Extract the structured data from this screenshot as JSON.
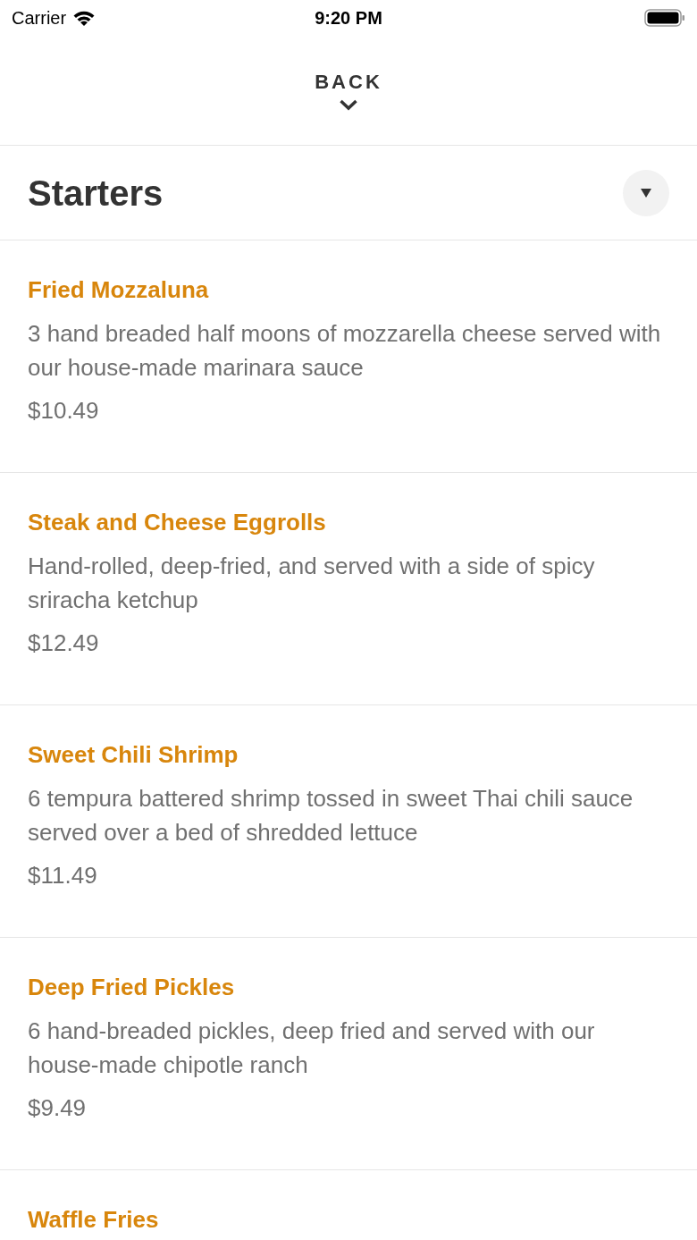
{
  "status_bar": {
    "carrier": "Carrier",
    "time": "9:20 PM"
  },
  "header": {
    "back_label": "BACK"
  },
  "section": {
    "title": "Starters"
  },
  "items": [
    {
      "name": "Fried Mozzaluna",
      "description": "3 hand breaded half moons of mozzarella cheese served with our house-made marinara sauce",
      "price": "$10.49"
    },
    {
      "name": "Steak and Cheese Eggrolls",
      "description": "Hand-rolled, deep-fried, and served with a side of spicy sriracha ketchup",
      "price": "$12.49"
    },
    {
      "name": "Sweet Chili Shrimp",
      "description": "6 tempura battered shrimp tossed in sweet Thai chili sauce served over a bed of shredded lettuce",
      "price": "$11.49"
    },
    {
      "name": "Deep Fried Pickles",
      "description": "6 hand-breaded pickles, deep fried and served with our house-made chipotle ranch",
      "price": "$9.49"
    },
    {
      "name": "Waffle Fries"
    }
  ]
}
